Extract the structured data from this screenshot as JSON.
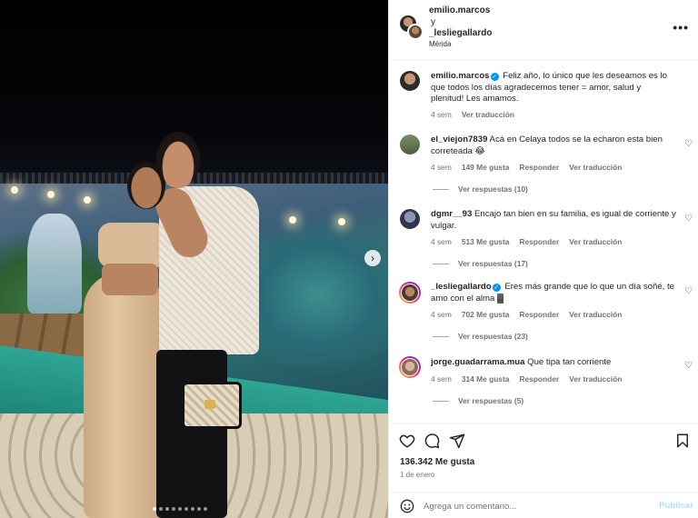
{
  "post": {
    "author_primary": "emilio.marcos",
    "and": "y",
    "author_secondary": "_lesliegallardo",
    "location": "Mérida",
    "more_glyph": "•••"
  },
  "caption": {
    "user": "emilio.marcos",
    "text": "Feliz año, lo único que les deseamos es lo que todos los días agradecemos tener = amor, salud y plenitud! Les amamos.",
    "time": "4 sem",
    "translate": "Ver traducción"
  },
  "comments": [
    {
      "user": "el_viejon7839",
      "verified": false,
      "text": "Acá en Celaya todos se la echaron esta bien correteada 😂",
      "time": "4 sem",
      "likes": "149 Me gusta",
      "reply": "Responder",
      "translate": "Ver traducción",
      "replies": "Ver respuestas (10)"
    },
    {
      "user": "dgmr__93",
      "verified": false,
      "text": "Encajo tan bien en su familia, es igual de corriente y vulgar.",
      "time": "4 sem",
      "likes": "513 Me gusta",
      "reply": "Responder",
      "translate": "Ver traducción",
      "replies": "Ver respuestas (17)"
    },
    {
      "user": "_lesliegallardo",
      "verified": true,
      "text": "Eres más grande que lo que un día soñé, te amo con el alma ▓",
      "time": "4 sem",
      "likes": "702 Me gusta",
      "reply": "Responder",
      "translate": "Ver traducción",
      "replies": "Ver respuestas (23)"
    },
    {
      "user": "jorge.guadarrama.mua",
      "verified": false,
      "text": "Que tipa tan corriente",
      "time": "4 sem",
      "likes": "314 Me gusta",
      "reply": "Responder",
      "translate": "Ver traducción",
      "replies": "Ver respuestas (5)"
    }
  ],
  "stats": {
    "likes": "136.342 Me gusta",
    "date": "1 de enero"
  },
  "composer": {
    "placeholder": "Agrega un comentario...",
    "publish": "Publicar"
  },
  "carousel": {
    "next_glyph": "›",
    "slide_count": 9,
    "active_slide": 1
  },
  "icons": {
    "heart": "heart-icon",
    "comment": "comment-icon",
    "share": "send-icon",
    "save": "bookmark-icon",
    "emoji": "emoji-icon",
    "verified": "verified-badge-icon",
    "more": "more-options-icon"
  },
  "colors": {
    "verified_blue": "#0095f6",
    "secondary_text": "#737373",
    "publish_disabled": "#b2dffc",
    "story_ring": [
      "#f9ce34",
      "#ee2a7b",
      "#6228d7"
    ]
  }
}
